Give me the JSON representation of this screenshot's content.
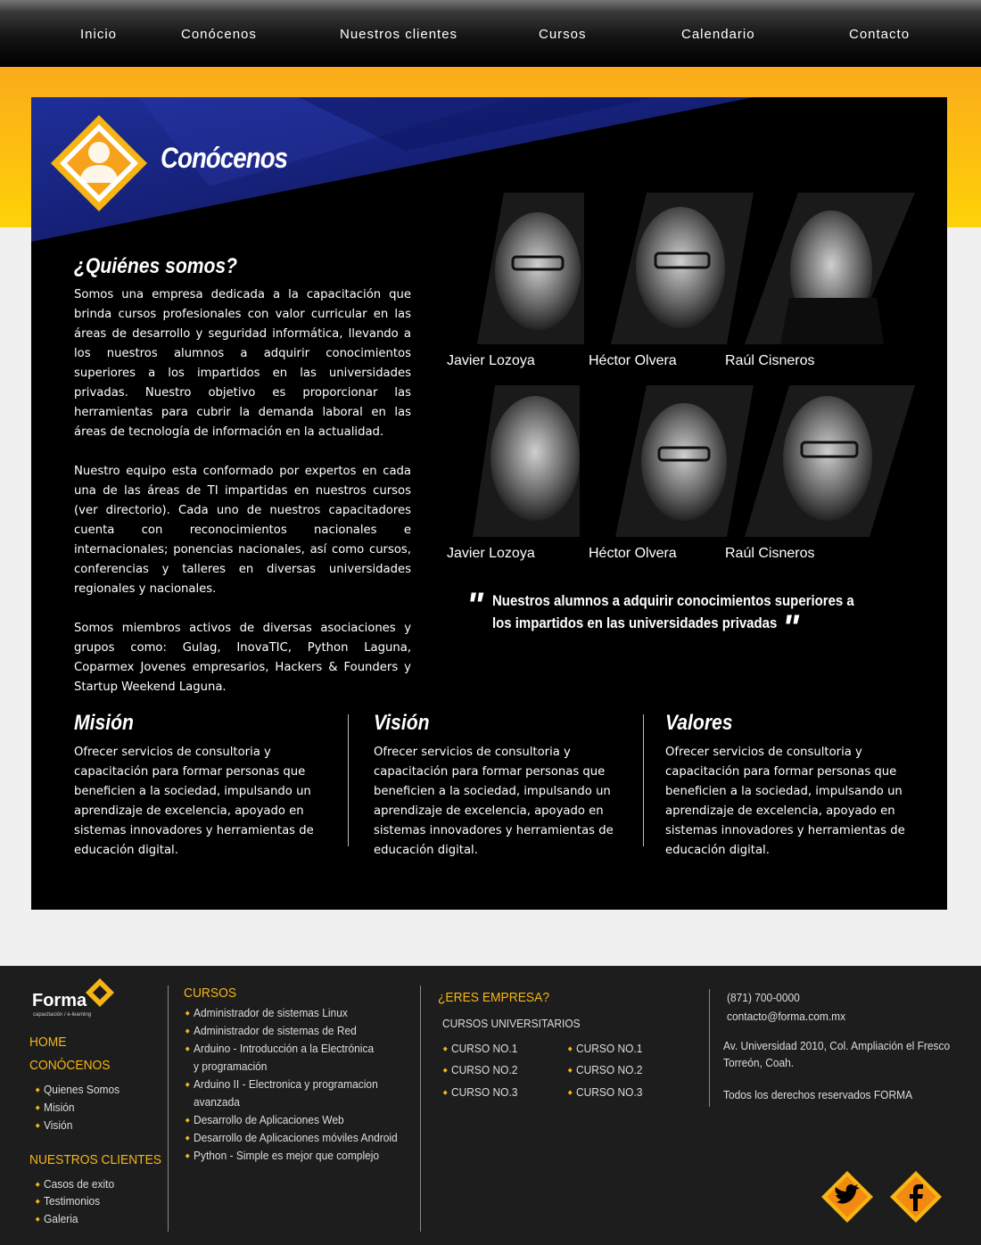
{
  "nav": {
    "items": [
      "Inicio",
      "Conócenos",
      "Nuestros clientes",
      "Cursos",
      "Calendario",
      "Contacto"
    ]
  },
  "main": {
    "title": "Conócenos",
    "about": {
      "heading": "¿Quiénes somos?",
      "p1": "Somos una empresa dedicada a la capacitación que brinda cursos profesionales con valor curricular en las áreas de desarrollo y seguridad informática, llevando a los nuestros alumnos a adquirir conocimientos superiores a los impartidos en las universidades privadas. Nuestro objetivo es proporcionar las herramientas para cubrir la demanda laboral en las áreas de tecnología de información en la actualidad.",
      "p2": "Nuestro equipo esta conformado por expertos en cada una de las áreas de TI impartidas en nuestros cursos (ver directorio). Cada uno de nuestros capacitadores cuenta con reconocimientos nacionales e internacionales; ponencias nacionales, así como cursos, conferencias y talleres en diversas universidades regionales y nacionales.",
      "p3": "Somos miembros activos de diversas asociaciones y grupos como: Gulag, InovaTIC, Python Laguna, Coparmex Jovenes empresarios, Hackers & Founders y Startup Weekend Laguna."
    },
    "team": [
      "Javier Lozoya",
      "Héctor Olvera",
      "Raúl Cisneros",
      "Javier Lozoya",
      "Héctor Olvera",
      "Raúl Cisneros"
    ],
    "quote": {
      "line1": "Nuestros alumnos a adquirir conocimientos superiores a",
      "line2": "los impartidos en las universidades privadas"
    },
    "mision": {
      "title": "Misión",
      "text": "Ofrecer servicios de consultoria y capacitación para formar personas que beneficien a la sociedad, impulsando un aprendizaje de excelencia, apoyado en sistemas innovadores y herramientas de educación digital."
    },
    "vision": {
      "title": "Visión",
      "text": "Ofrecer servicios de consultoria y capacitación para formar personas que beneficien a la sociedad, impulsando un aprendizaje de excelencia, apoyado en sistemas innovadores y herramientas de educación digital."
    },
    "valores": {
      "title": "Valores",
      "text": "Ofrecer servicios de consultoria y capacitación para formar personas que beneficien a la sociedad, impulsando un aprendizaje de excelencia, apoyado en sistemas innovadores y herramientas de educación digital."
    }
  },
  "footer": {
    "logo": {
      "name": "Forma",
      "tagline": "capacitación / e-learning"
    },
    "home": "HOME",
    "conocenos": "CONÓCENOS",
    "conocenos_items": [
      "Quienes Somos",
      "Misión",
      "Visión"
    ],
    "clientes": "NUESTROS CLIENTES",
    "clientes_items": [
      "Casos de exito",
      "Testimonios",
      "Galeria"
    ],
    "cursos_title": "CURSOS",
    "cursos": [
      "Administrador de sistemas Linux",
      "Administrador de sistemas de Red",
      "Arduino - Introducción a la Electrónica",
      "y programación",
      "Arduino II - Electronica y programacion",
      "avanzada",
      "Desarrollo de Aplicaciones Web",
      "Desarrollo de Aplicaciones móviles Android",
      "Python - Simple es mejor que complejo"
    ],
    "empresa_title": "¿ERES EMPRESA?",
    "univ_title": "CURSOS UNIVERSITARIOS",
    "univ_col1": [
      "CURSO NO.1",
      "CURSO NO.2",
      "CURSO NO.3"
    ],
    "univ_col2": [
      "CURSO NO.1",
      "CURSO NO.2",
      "CURSO NO.3"
    ],
    "phone": "(871) 700-0000",
    "email": "contacto@forma.com.mx",
    "address1": "Av. Universidad 2010, Col. Ampliación el Fresco",
    "address2": "Torreón, Coah.",
    "rights": "Todos los derechos reservados FORMA",
    "social": [
      "twitter-icon",
      "facebook-icon"
    ]
  },
  "colors": {
    "accent": "#f6b515",
    "blue": "#13207a",
    "panel": "#000000",
    "footer": "#1d1d1d"
  }
}
